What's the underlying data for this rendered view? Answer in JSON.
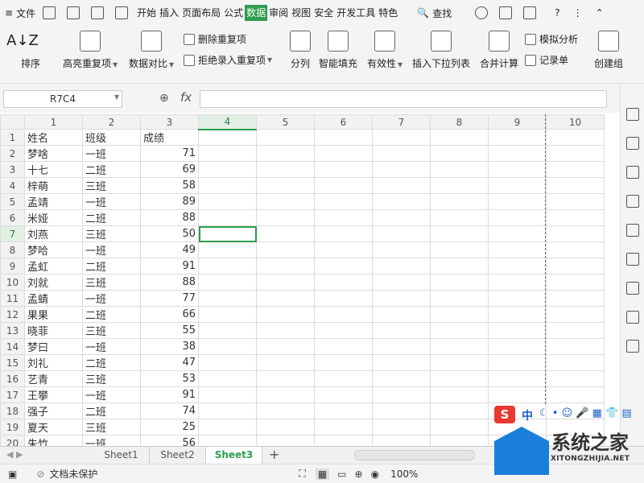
{
  "titlebar": {
    "menu_label": "文件",
    "tabs": [
      "开始",
      "插入",
      "页面布局",
      "公式",
      "数据",
      "审阅",
      "视图",
      "安全",
      "开发工具",
      "特色"
    ],
    "active_tab": "数据",
    "search_label": "查找"
  },
  "ribbon": {
    "sort": "排序",
    "highlight_dup": "高亮重复项",
    "compare": "数据对比",
    "delete_dup": "删除重复项",
    "reject_dup": "拒绝录入重复项",
    "split": "分列",
    "smart_fill": "智能填充",
    "validity": "有效性",
    "insert_dropdown": "插入下拉列表",
    "merge_calc": "合并计算",
    "simulate": "模拟分析",
    "record": "记录单",
    "create_group": "创建组"
  },
  "formula_bar": {
    "name_box": "R7C4",
    "fx": "fx",
    "value": ""
  },
  "grid": {
    "columns": [
      "1",
      "2",
      "3",
      "4",
      "5",
      "6",
      "7",
      "8",
      "9",
      "10"
    ],
    "selected_col": "4",
    "selected_row": "7",
    "rows": [
      [
        "姓名",
        "班级",
        "成绩"
      ],
      [
        "梦啥",
        "一班",
        "71"
      ],
      [
        "十七",
        "二班",
        "69"
      ],
      [
        "梓萌",
        "三班",
        "58"
      ],
      [
        "孟靖",
        "一班",
        "89"
      ],
      [
        "米娅",
        "二班",
        "88"
      ],
      [
        "刘燕",
        "三班",
        "50"
      ],
      [
        "梦哈",
        "一班",
        "49"
      ],
      [
        "孟虹",
        "二班",
        "91"
      ],
      [
        "刘就",
        "三班",
        "88"
      ],
      [
        "孟蜻",
        "一班",
        "77"
      ],
      [
        "果果",
        "二班",
        "66"
      ],
      [
        "晓菲",
        "三班",
        "55"
      ],
      [
        "梦曰",
        "一班",
        "38"
      ],
      [
        "刘礼",
        "二班",
        "47"
      ],
      [
        "艺青",
        "三班",
        "53"
      ],
      [
        "王攀",
        "一班",
        "91"
      ],
      [
        "强子",
        "二班",
        "74"
      ],
      [
        "夏天",
        "三班",
        "25"
      ],
      [
        "朱竹",
        "一班",
        "56"
      ],
      [
        "",
        "",
        ""
      ],
      [
        "",
        "",
        ""
      ]
    ]
  },
  "sheets": [
    "Sheet1",
    "Sheet2",
    "Sheet3"
  ],
  "active_sheet": "Sheet3",
  "status": {
    "protect": "文档未保护",
    "zoom": "100%"
  },
  "watermark": {
    "name": "系统之家",
    "url": "XITONGZHIJIA.NET",
    "ime": "中"
  }
}
